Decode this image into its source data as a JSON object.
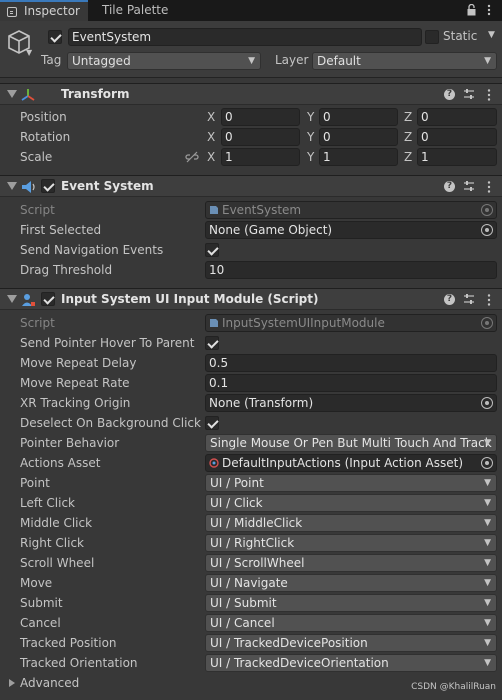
{
  "tabs": {
    "inspector": "Inspector",
    "tile_palette": "Tile Palette"
  },
  "header": {
    "object_name": "EventSystem",
    "static_label": "Static",
    "tag_label": "Tag",
    "tag_value": "Untagged",
    "layer_label": "Layer",
    "layer_value": "Default"
  },
  "transform": {
    "title": "Transform",
    "position_label": "Position",
    "rotation_label": "Rotation",
    "scale_label": "Scale",
    "x": "X",
    "y": "Y",
    "z": "Z",
    "position": [
      "0",
      "0",
      "0"
    ],
    "rotation": [
      "0",
      "0",
      "0"
    ],
    "scale": [
      "1",
      "1",
      "1"
    ]
  },
  "event_system": {
    "title": "Event System",
    "script_label": "Script",
    "script_value": "EventSystem",
    "first_selected_label": "First Selected",
    "first_selected_value": "None (Game Object)",
    "send_nav_label": "Send Navigation Events",
    "drag_threshold_label": "Drag Threshold",
    "drag_threshold_value": "10"
  },
  "input_module": {
    "title": "Input System UI Input Module (Script)",
    "script_label": "Script",
    "script_value": "InputSystemUIInputModule",
    "pointer_hover_label": "Send Pointer Hover To Parent",
    "move_delay_label": "Move Repeat Delay",
    "move_delay_value": "0.5",
    "move_rate_label": "Move Repeat Rate",
    "move_rate_value": "0.1",
    "xr_origin_label": "XR Tracking Origin",
    "xr_origin_value": "None (Transform)",
    "deselect_label": "Deselect On Background Click",
    "pointer_behavior_label": "Pointer Behavior",
    "pointer_behavior_value": "Single Mouse Or Pen But Multi Touch And Track",
    "actions_asset_label": "Actions Asset",
    "actions_asset_value": "DefaultInputActions (Input Action Asset)",
    "actions": [
      {
        "label": "Point",
        "value": "UI / Point"
      },
      {
        "label": "Left Click",
        "value": "UI / Click"
      },
      {
        "label": "Middle Click",
        "value": "UI / MiddleClick"
      },
      {
        "label": "Right Click",
        "value": "UI / RightClick"
      },
      {
        "label": "Scroll Wheel",
        "value": "UI / ScrollWheel"
      },
      {
        "label": "Move",
        "value": "UI / Navigate"
      },
      {
        "label": "Submit",
        "value": "UI / Submit"
      },
      {
        "label": "Cancel",
        "value": "UI / Cancel"
      },
      {
        "label": "Tracked Position",
        "value": "UI / TrackedDevicePosition"
      },
      {
        "label": "Tracked Orientation",
        "value": "UI / TrackedDeviceOrientation"
      }
    ],
    "advanced_label": "Advanced"
  },
  "watermark": "CSDN @KhalilRuan",
  "colors": {
    "background": "#383838",
    "tab_bar": "#191919",
    "accent": "#3a79bb",
    "field": "#2a2a2a",
    "dropdown": "#515151"
  }
}
